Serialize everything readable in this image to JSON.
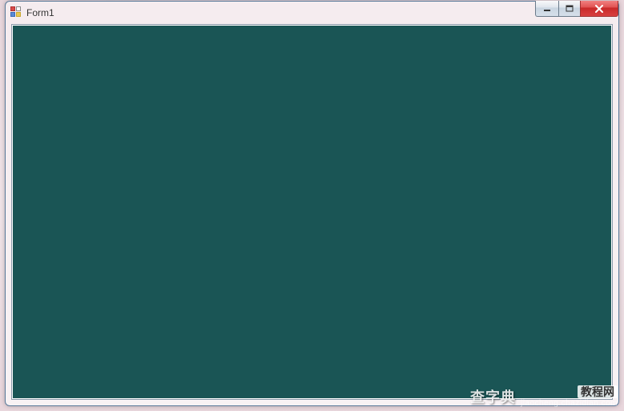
{
  "window": {
    "title": "Form1"
  },
  "controls": {
    "minimize_tooltip": "Minimize",
    "maximize_tooltip": "Maximize",
    "close_tooltip": "Close"
  },
  "panel": {
    "background_color": "#1a5555"
  },
  "watermark": {
    "brand": "查字典",
    "boxed_label": "教程网",
    "url": "jiaocheng.chazidian.com"
  }
}
